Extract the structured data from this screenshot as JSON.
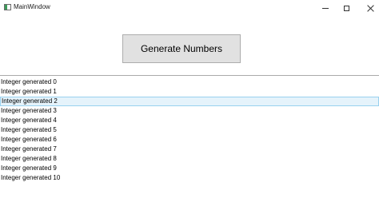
{
  "window": {
    "title": "MainWindow"
  },
  "main": {
    "generate_button_label": "Generate Numbers"
  },
  "list": {
    "items": [
      "Integer generated 0",
      "Integer generated 1",
      "Integer generated 2",
      "Integer generated 3",
      "Integer generated 4",
      "Integer generated 5",
      "Integer generated 6",
      "Integer generated 7",
      "Integer generated 8",
      "Integer generated 9",
      "Integer generated 10"
    ],
    "selected_index": 2
  },
  "colors": {
    "button_background": "#e1e1e1",
    "selection_background": "#e5f3fb",
    "selection_border": "#99d1ef"
  },
  "icons": {
    "minimize": "minimize-icon",
    "maximize": "maximize-icon",
    "close": "close-icon"
  }
}
